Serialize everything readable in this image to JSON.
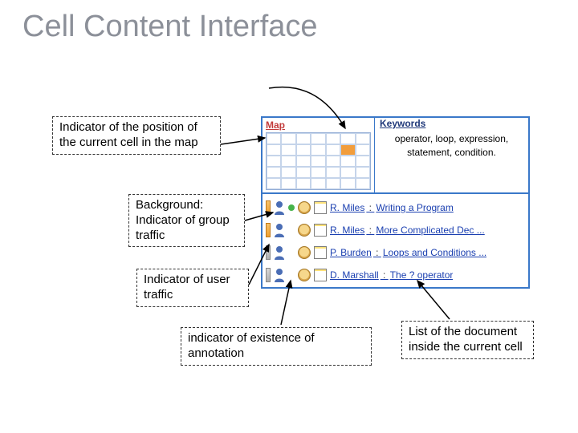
{
  "title": "Cell Content Interface",
  "callouts": {
    "position": "Indicator of the position of the current cell in the map",
    "background": "Background:\nIndicator of group traffic",
    "user": "Indicator of user traffic",
    "annotation": "indicator of existence of annotation",
    "list": "List of the document inside the current cell"
  },
  "panel": {
    "map_label": "Map",
    "keywords_label": "Keywords",
    "keywords": "operator, loop, expression, statement, condition.",
    "docs": [
      {
        "author": "R. Miles",
        "title": "Writing a Program"
      },
      {
        "author": "R. Miles",
        "title": "More Complicated Dec ..."
      },
      {
        "author": "P. Burden",
        "title": "Loops and Conditions ..."
      },
      {
        "author": "D. Marshall",
        "title": "The ? operator"
      }
    ]
  }
}
